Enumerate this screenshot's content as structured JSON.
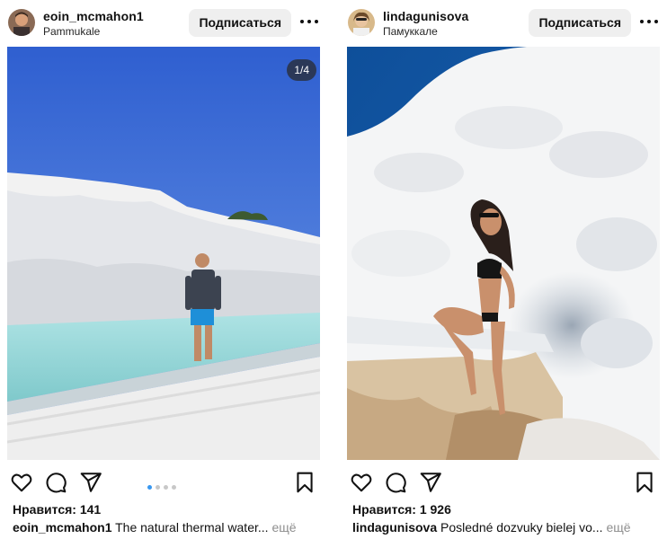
{
  "posts": [
    {
      "username": "eoin_mcmahon1",
      "location": "Pammukale",
      "follow_label": "Подписаться",
      "more_icon": "more-horizontal-icon",
      "image_counter": "1/4",
      "carousel": {
        "count": 4,
        "active": 1
      },
      "likes": "Нравится: 141",
      "caption_user": "eoin_mcmahon1",
      "caption_text": "The natural thermal water...",
      "caption_more": "ещё"
    },
    {
      "username": "lindagunisova",
      "location": "Памуккале",
      "follow_label": "Подписаться",
      "more_icon": "more-horizontal-icon",
      "likes": "Нравится: 1 926",
      "caption_user": "lindagunisova",
      "caption_text": "Posledné dozvuky bielej vo...",
      "caption_more": "ещё"
    }
  ],
  "icons": [
    "heart-icon",
    "comment-icon",
    "share-icon",
    "bookmark-icon"
  ],
  "colors": {
    "follow_bg": "#efefef",
    "dot_active": "#3897f0",
    "muted": "#8e8e8e"
  }
}
